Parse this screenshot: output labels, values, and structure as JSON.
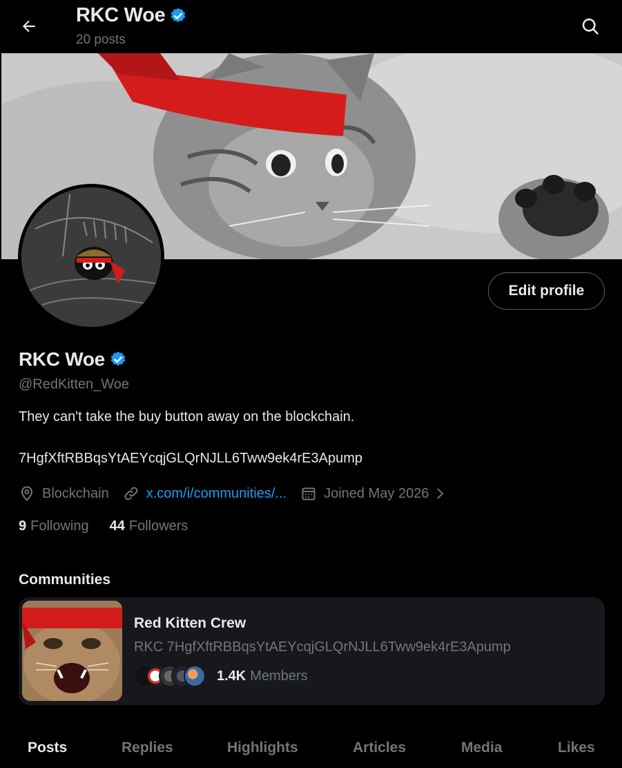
{
  "header": {
    "name": "RKC Woe",
    "posts_count": "20 posts",
    "back_icon": "arrow-left-icon",
    "search_icon": "search-icon"
  },
  "profile": {
    "name": "RKC Woe",
    "handle": "@RedKitten_Woe",
    "bio": "They can't take the buy button away on the blockchain.",
    "contract": "7HgfXftRBBqsYtAEYcqjGLQrNJLL6Tww9ek4rE3Apump",
    "location": "Blockchain",
    "link": "x.com/i/communities/...",
    "joined": "Joined May 2026",
    "following_count": "9",
    "following_label": "Following",
    "followers_count": "44",
    "followers_label": "Followers",
    "edit_button": "Edit profile"
  },
  "communities": {
    "heading": "Communities",
    "items": [
      {
        "name": "Red Kitten Crew",
        "description": "RKC 7HgfXftRBBqsYtAEYcqjGLQrNJLL6Tww9ek4rE3Apump",
        "member_count": "1.4K",
        "member_label": "Members"
      }
    ]
  },
  "tabs": [
    "Posts",
    "Replies",
    "Highlights",
    "Articles",
    "Media",
    "Likes"
  ],
  "colors": {
    "accent": "#1d9bf0",
    "headband": "#d41c1c",
    "muted": "#71767b"
  }
}
